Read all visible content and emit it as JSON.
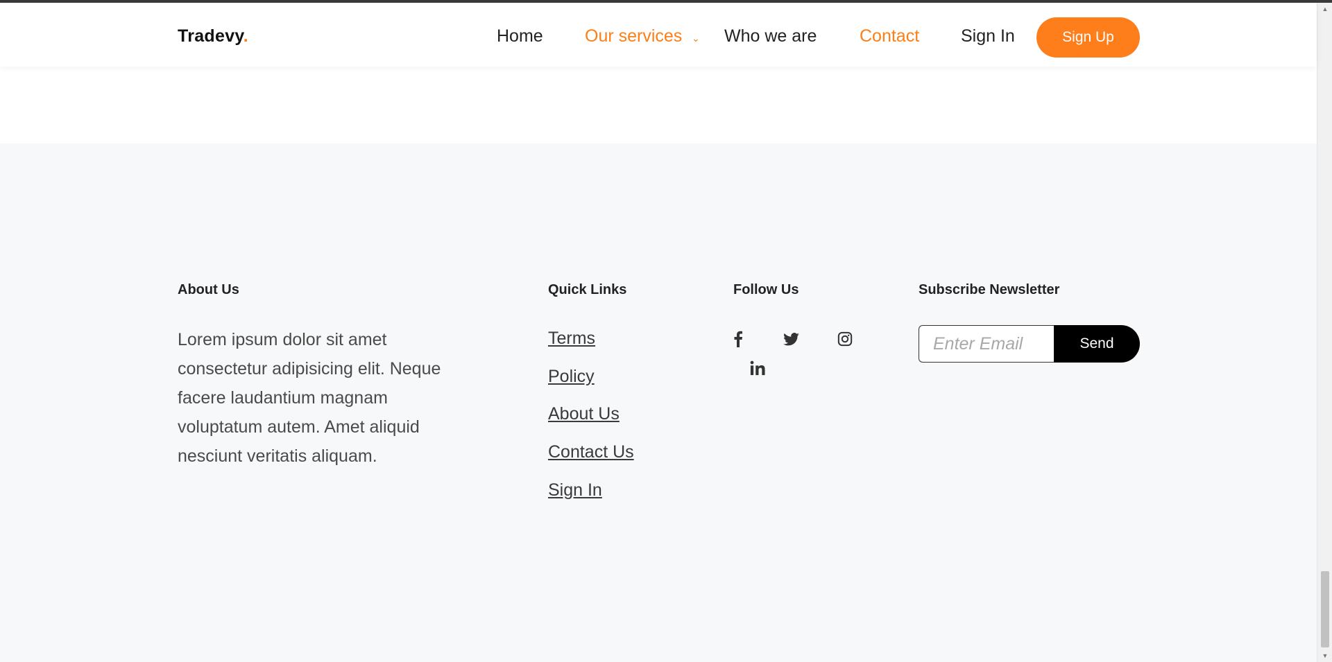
{
  "navbar": {
    "brand": "Tradevy",
    "brand_dot": ".",
    "links": [
      {
        "label": "Home",
        "active": false
      },
      {
        "label": "Our services",
        "active": true,
        "has_dropdown": true
      },
      {
        "label": "Who we are",
        "active": false
      },
      {
        "label": "Contact",
        "active": true
      },
      {
        "label": "Sign In",
        "active": false
      }
    ],
    "chevron_glyph": "⌄",
    "signup_label": "Sign Up"
  },
  "footer": {
    "about": {
      "heading": "About Us",
      "text": "Lorem ipsum dolor sit amet consectetur adipisicing elit. Neque facere laudantium magnam voluptatum autem. Amet aliquid nesciunt veritatis aliquam."
    },
    "quick_links": {
      "heading": "Quick Links",
      "items": [
        "Terms",
        "Policy",
        "About Us",
        "Contact Us",
        "Sign In"
      ]
    },
    "follow": {
      "heading": "Follow Us",
      "icons": [
        "facebook-icon",
        "twitter-icon",
        "instagram-icon",
        "linkedin-icon"
      ]
    },
    "newsletter": {
      "heading": "Subscribe Newsletter",
      "email_placeholder": "Enter Email",
      "send_label": "Send"
    }
  },
  "colors": {
    "accent": "#fd7e14",
    "footer_bg": "#f7f8f9",
    "send_button": "#000000"
  }
}
